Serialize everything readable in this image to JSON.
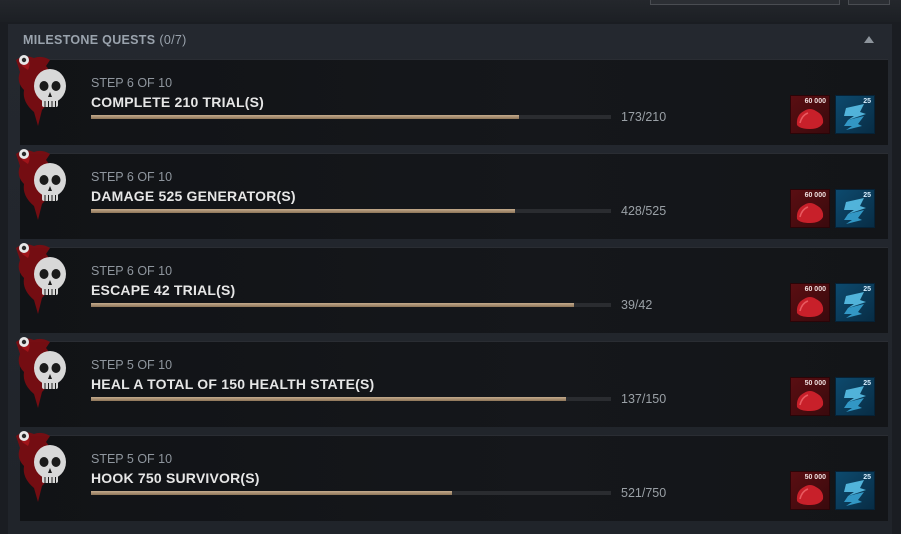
{
  "section": {
    "title": "MILESTONE QUESTS",
    "count": "(0/7)"
  },
  "quests": [
    {
      "step": "STEP 6 OF 10",
      "title": "COMPLETE 210 TRIAL(S)",
      "progress_text": "173/210",
      "progress": 0.824,
      "icon": "skull-splash-icon",
      "bp_reward": "60 000",
      "rift_reward": "25"
    },
    {
      "step": "STEP 6 OF 10",
      "title": "DAMAGE 525 GENERATOR(S)",
      "progress_text": "428/525",
      "progress": 0.815,
      "icon": "skull-icon",
      "bp_reward": "60 000",
      "rift_reward": "25"
    },
    {
      "step": "STEP 6 OF 10",
      "title": "ESCAPE 42 TRIAL(S)",
      "progress_text": "39/42",
      "progress": 0.929,
      "icon": "ornate-skull-icon",
      "bp_reward": "60 000",
      "rift_reward": "25"
    },
    {
      "step": "STEP 5 OF 10",
      "title": "HEAL A TOTAL OF 150 HEALTH STATE(S)",
      "progress_text": "137/150",
      "progress": 0.913,
      "icon": "ornate-skull-icon",
      "bp_reward": "50 000",
      "rift_reward": "25"
    },
    {
      "step": "STEP 5 OF 10",
      "title": "HOOK 750 SURVIVOR(S)",
      "progress_text": "521/750",
      "progress": 0.695,
      "icon": "skull-icon",
      "bp_reward": "50 000",
      "rift_reward": "25"
    }
  ],
  "colors": {
    "blood": "#8a0f14",
    "bp_reward": "#5a0e12",
    "rift_reward": "#0d4a6e",
    "progress": "#b49a7c"
  }
}
